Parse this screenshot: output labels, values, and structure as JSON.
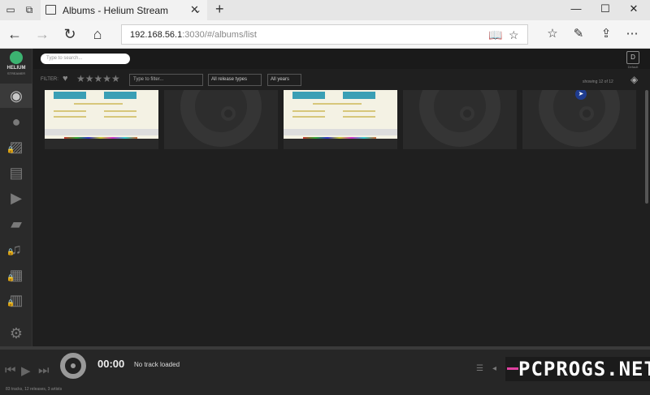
{
  "browser": {
    "tab_title": "Albums - Helium Stream",
    "url_host": "192.168.56.1",
    "url_rest": ":3030/#/albums/list"
  },
  "app": {
    "logo_name": "HELIUM",
    "logo_sub": "STREAMER",
    "search_placeholder": "Type to search...",
    "user_initial": "D",
    "user_label": "Default"
  },
  "filters": {
    "label": "FILTER:",
    "filter_placeholder": "Type to filter...",
    "release_types": "All release types",
    "years": "All years",
    "showing": "showing 12 of 12"
  },
  "sidebar": {
    "items": [
      {
        "icon": "disc-icon",
        "active": true
      },
      {
        "icon": "user-icon",
        "active": false
      },
      {
        "icon": "image-icon",
        "active": false,
        "locked": true
      },
      {
        "icon": "document-icon",
        "active": false
      },
      {
        "icon": "video-icon",
        "active": false
      },
      {
        "icon": "folder-icon",
        "active": false
      },
      {
        "icon": "music-icon",
        "active": false,
        "locked": true
      },
      {
        "icon": "calendar-icon",
        "active": false,
        "locked": true
      },
      {
        "icon": "chart-icon",
        "active": false,
        "locked": true
      },
      {
        "icon": "gear-icon",
        "active": false
      }
    ]
  },
  "player": {
    "time": "00:00",
    "track": "No track loaded",
    "stats": "83 tracks, 12 releases, 3 artists"
  },
  "watermark": "PCPROGS.NET"
}
